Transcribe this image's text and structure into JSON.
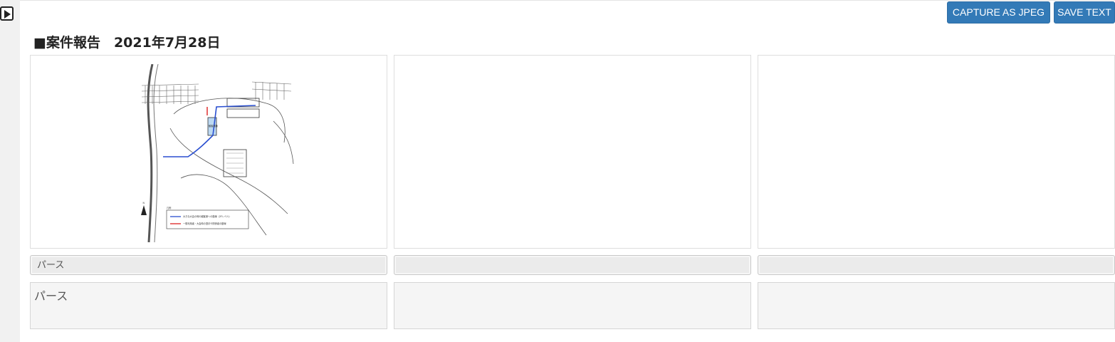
{
  "sidebar": {
    "toggle_icon": "play-icon"
  },
  "toolbar": {
    "capture_label": "CAPTURE AS JPEG",
    "save_label": "SAVE TEXT",
    "accent": "#337ab7"
  },
  "report": {
    "title": "■案件報告　2021年7月28日"
  },
  "cards": [
    {
      "image": "site-map",
      "caption": "パース",
      "note": "パース"
    },
    {
      "image": "",
      "caption": "",
      "note": ""
    },
    {
      "image": "",
      "caption": "",
      "note": ""
    }
  ],
  "map_labels": {
    "legend_title": "凡例",
    "legend_blue": "大きな大会の時の観客席への動線（2Fレベル）",
    "legend_red": "一般利用者・大会時の選手や関係者の動線",
    "building": "観客席棟",
    "north": "N"
  }
}
